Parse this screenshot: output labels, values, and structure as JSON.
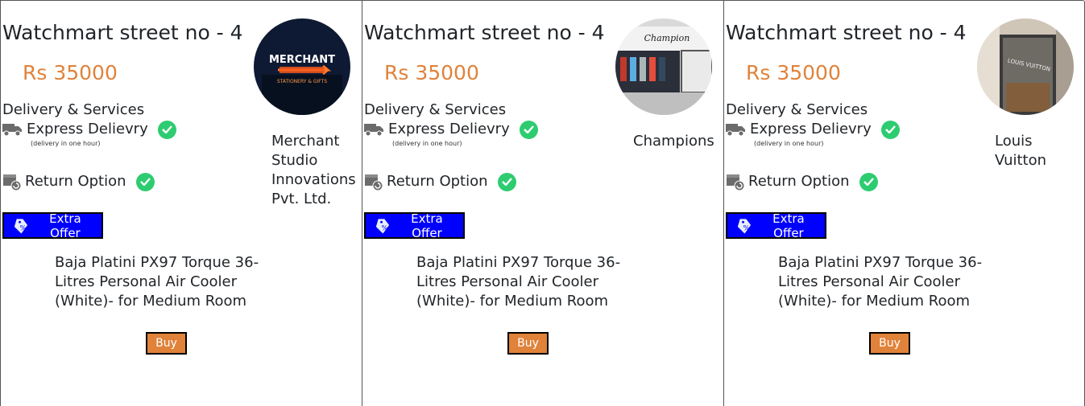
{
  "colors": {
    "price": "#e0823a",
    "offer_bg": "#0000ff",
    "buy_bg": "#e0823a",
    "check": "#2ecc71"
  },
  "cards": [
    {
      "store_title": "Watchmart street no - 4",
      "price": "Rs 35000",
      "services_heading": "Delivery & Services",
      "express_label": "Express Delievry",
      "express_note": "(delivery in one hour)",
      "return_label": "Return Option",
      "offer_label": "Extra Offer",
      "product_name": "Baja Platini PX97 Torque 36-Litres Personal Air Cooler (White)- for Medium Room",
      "buy_label": "Buy",
      "store_name": "Merchant Studio Innovations Pvt. Ltd.",
      "logo": {
        "icon": "merchant-storefront-photo",
        "text_main": "MERCHANT",
        "text_sub": "STATIONERY & GIFTS"
      }
    },
    {
      "store_title": "Watchmart street no - 4",
      "price": "Rs 35000",
      "services_heading": "Delivery & Services",
      "express_label": "Express Delievry",
      "express_note": "(delivery in one hour)",
      "return_label": "Return Option",
      "offer_label": "Extra Offer",
      "product_name": "Baja Platini PX97 Torque 36-Litres Personal Air Cooler (White)- for Medium Room",
      "buy_label": "Buy",
      "store_name": "Champions",
      "logo": {
        "icon": "champion-storefront-photo",
        "text_main": "Champion"
      }
    },
    {
      "store_title": "Watchmart street no - 4",
      "price": "Rs 35000",
      "services_heading": "Delivery & Services",
      "express_label": "Express Delievry",
      "express_note": "(delivery in one hour)",
      "return_label": "Return Option",
      "offer_label": "Extra Offer",
      "product_name": "Baja Platini PX97 Torque 36-Litres Personal Air Cooler (White)- for Medium Room",
      "buy_label": "Buy",
      "store_name": "Louis Vuitton",
      "logo": {
        "icon": "louis-vuitton-storefront-photo",
        "text_main": "LOUIS VUITTON"
      }
    }
  ]
}
